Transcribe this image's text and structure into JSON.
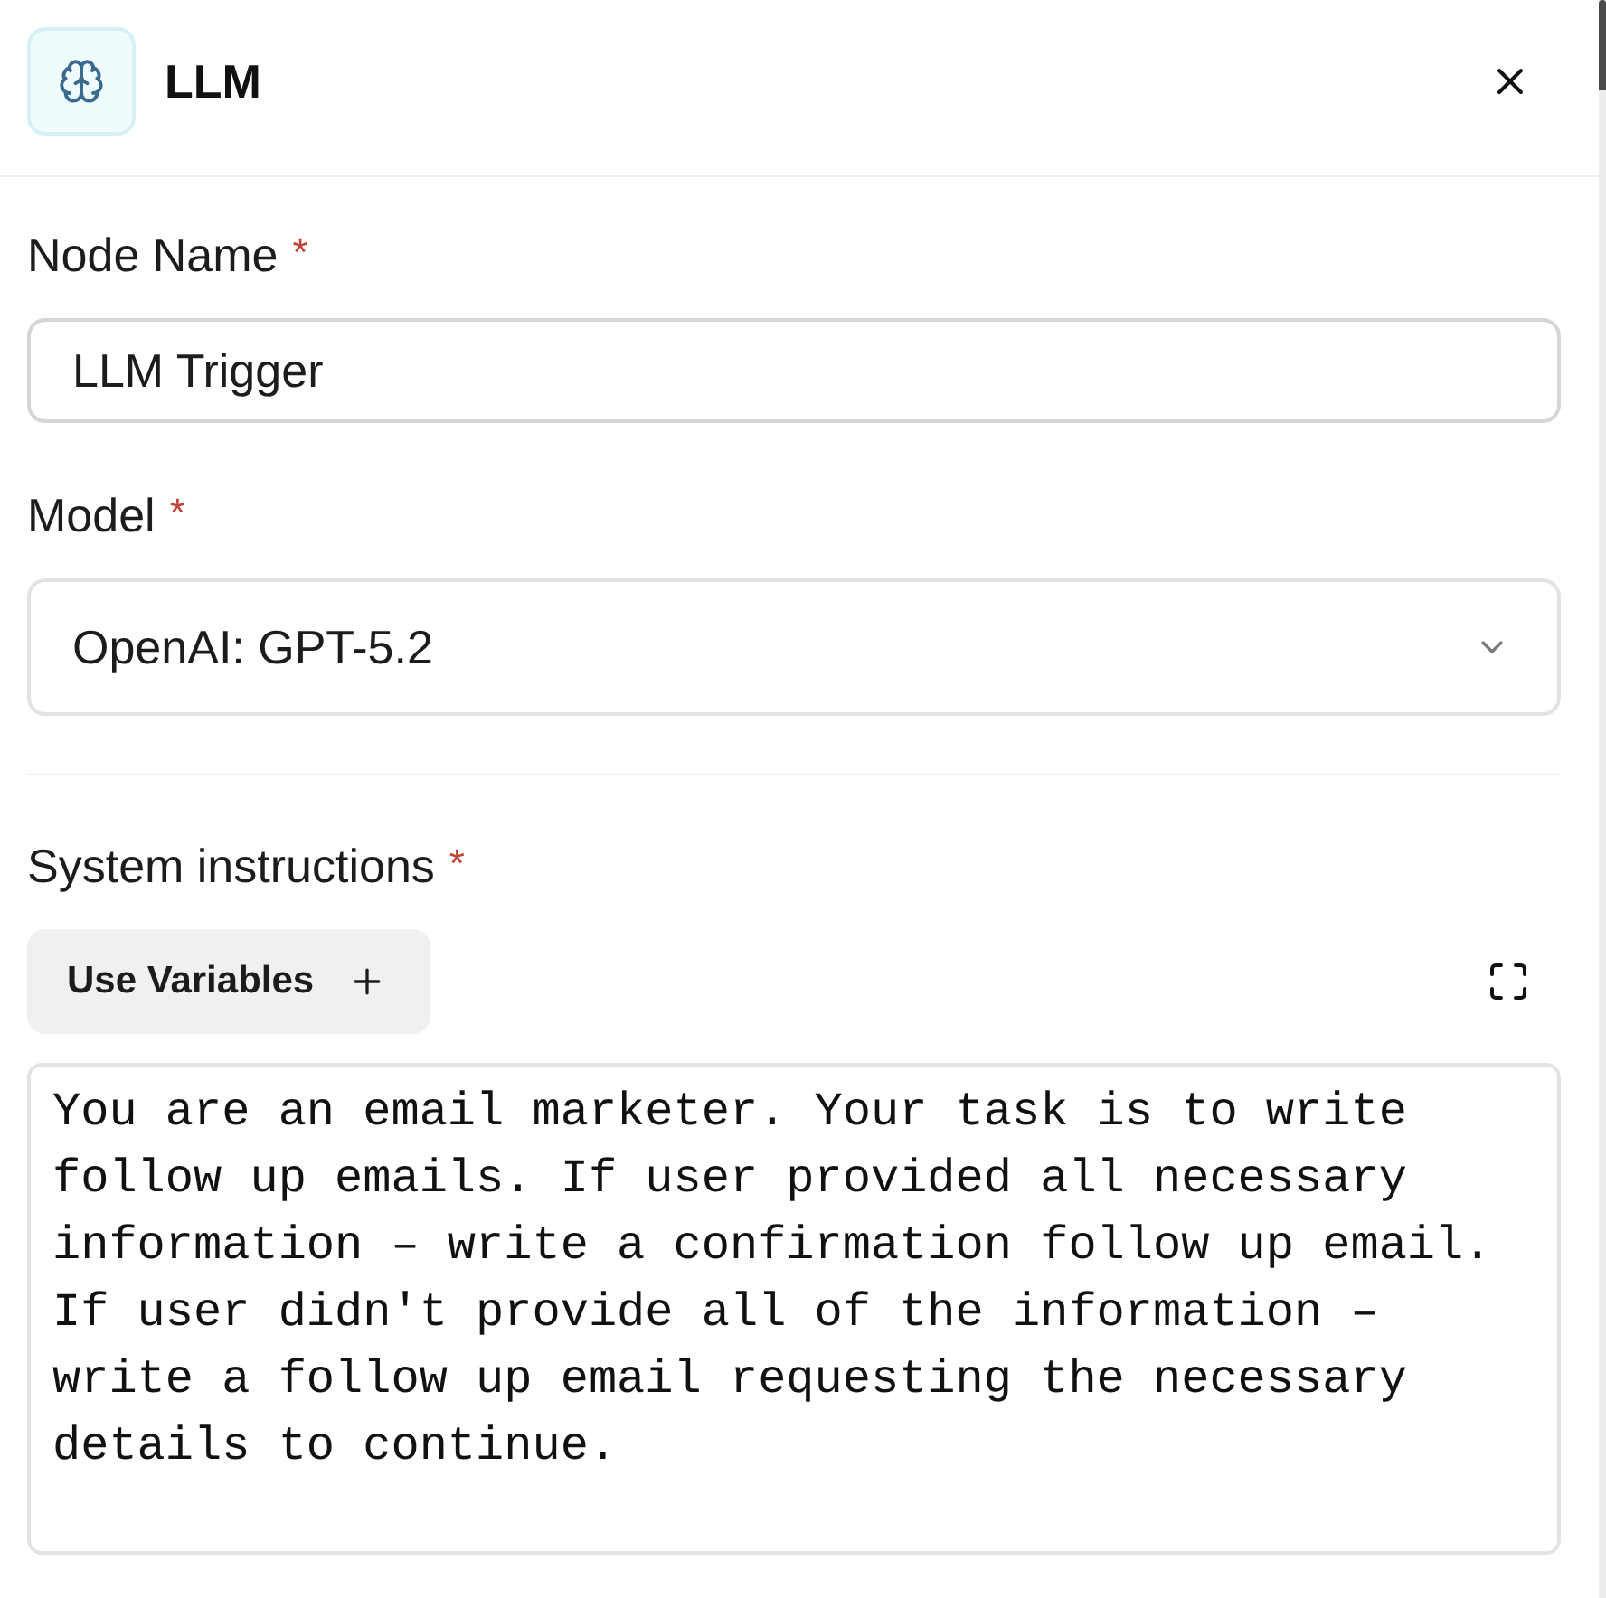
{
  "header": {
    "title": "LLM"
  },
  "fields": [
    {
      "kind": "input",
      "label": "Node Name",
      "required_mark": "*",
      "value": "LLM Trigger"
    },
    {
      "kind": "select",
      "label": "Model",
      "required_mark": "*",
      "value": "OpenAI: GPT-5.2"
    }
  ],
  "instructions": {
    "label": "System instructions",
    "required_mark": "*",
    "button": "Use Variables",
    "value": "You are an email marketer. Your task is to write follow up emails. If user provided all necessary information – write a confirmation follow up email. If user didn't provide all of the information – write a follow up email requesting the necessary details to continue."
  }
}
